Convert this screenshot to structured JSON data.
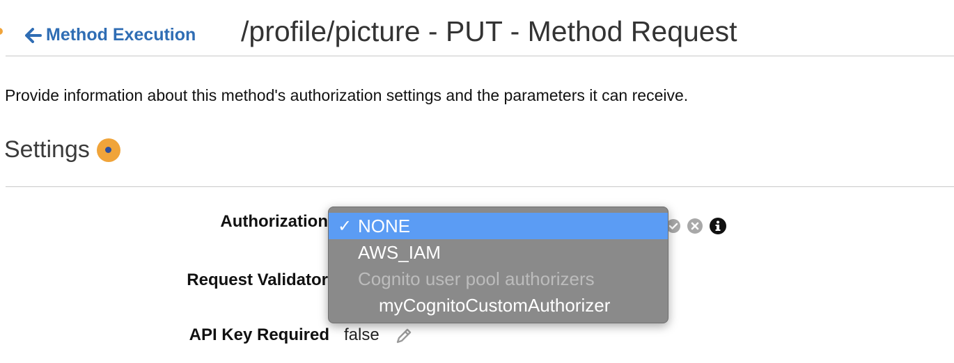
{
  "header": {
    "back_label": "Method Execution",
    "title": "/profile/picture - PUT - Method Request"
  },
  "description": "Provide information about this method's authorization settings and the parameters it can receive.",
  "settings": {
    "title": "Settings",
    "authorization_label": "Authorization",
    "request_validator_label": "Request Validator",
    "api_key_label": "API Key Required",
    "api_key_value": "false"
  },
  "authorization_dropdown": {
    "selected": "NONE",
    "check_mark": "✓",
    "options": [
      {
        "label": "NONE",
        "selected": true,
        "disabled": false
      },
      {
        "label": "AWS_IAM",
        "selected": false,
        "disabled": false
      },
      {
        "label": "Cognito user pool authorizers",
        "selected": false,
        "disabled": true
      },
      {
        "label": "myCognitoCustomAuthorizer",
        "selected": false,
        "disabled": false
      }
    ]
  },
  "icons": {
    "back": "arrow-left-icon",
    "status": "status-dot-icon",
    "confirm": "checkmark-circle-icon",
    "cancel": "cancel-circle-icon",
    "info": "info-icon",
    "edit": "pencil-icon"
  },
  "colors": {
    "link": "#2f6db4",
    "status": "#f0a43a",
    "dropdown_bg": "#8a8a8a",
    "dropdown_selected": "#5b9cf4"
  }
}
